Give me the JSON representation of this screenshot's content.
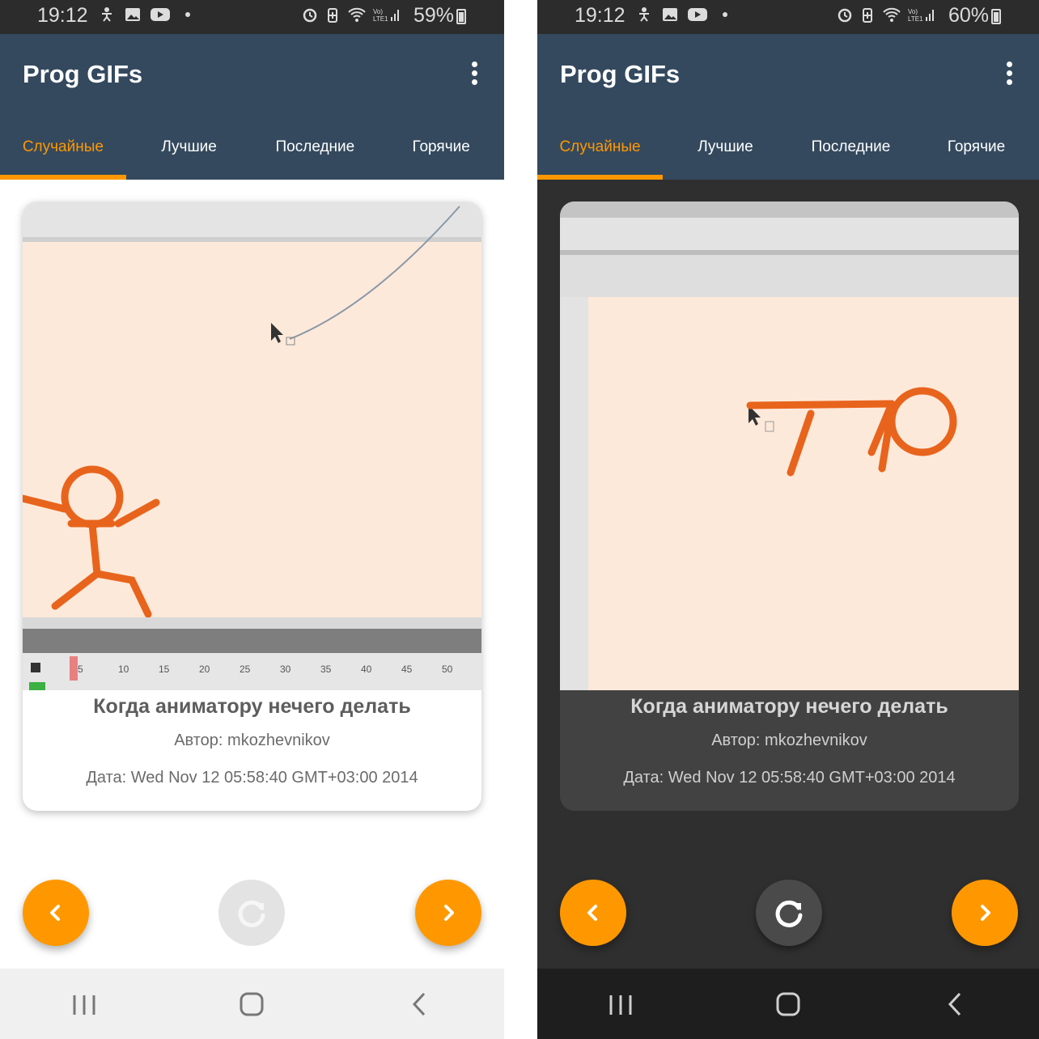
{
  "light": {
    "status": {
      "time": "19:12",
      "battery": "59%"
    },
    "app": {
      "title": "Prog GIFs"
    },
    "tabs": [
      "Случайные",
      "Лучшие",
      "Последние",
      "Горячие"
    ],
    "post": {
      "title": "Когда аниматору нечего делать",
      "author": "Автор: mkozhevnikov",
      "date": "Дата: Wed Nov 12 05:58:40 GMT+03:00 2014",
      "timeline_ticks": [
        "5",
        "10",
        "15",
        "20",
        "25",
        "30",
        "35",
        "40",
        "45",
        "50"
      ]
    },
    "buttons": {
      "prev": "prev-icon",
      "reload": "reload-icon",
      "next": "next-icon",
      "reload_enabled": false
    }
  },
  "dark": {
    "status": {
      "time": "19:12",
      "battery": "60%"
    },
    "app": {
      "title": "Prog GIFs"
    },
    "tabs": [
      "Случайные",
      "Лучшие",
      "Последние",
      "Горячие"
    ],
    "post": {
      "title": "Когда аниматору нечего делать",
      "author": "Автор: mkozhevnikov",
      "date": "Дата: Wed Nov 12 05:58:40 GMT+03:00 2014"
    },
    "buttons": {
      "prev": "prev-icon",
      "reload": "reload-icon",
      "next": "next-icon",
      "reload_enabled": true
    }
  },
  "colors": {
    "accent": "#ff9800",
    "appbar": "#34495e",
    "dark_bg": "#2f2f2f",
    "dark_card": "#424242"
  }
}
